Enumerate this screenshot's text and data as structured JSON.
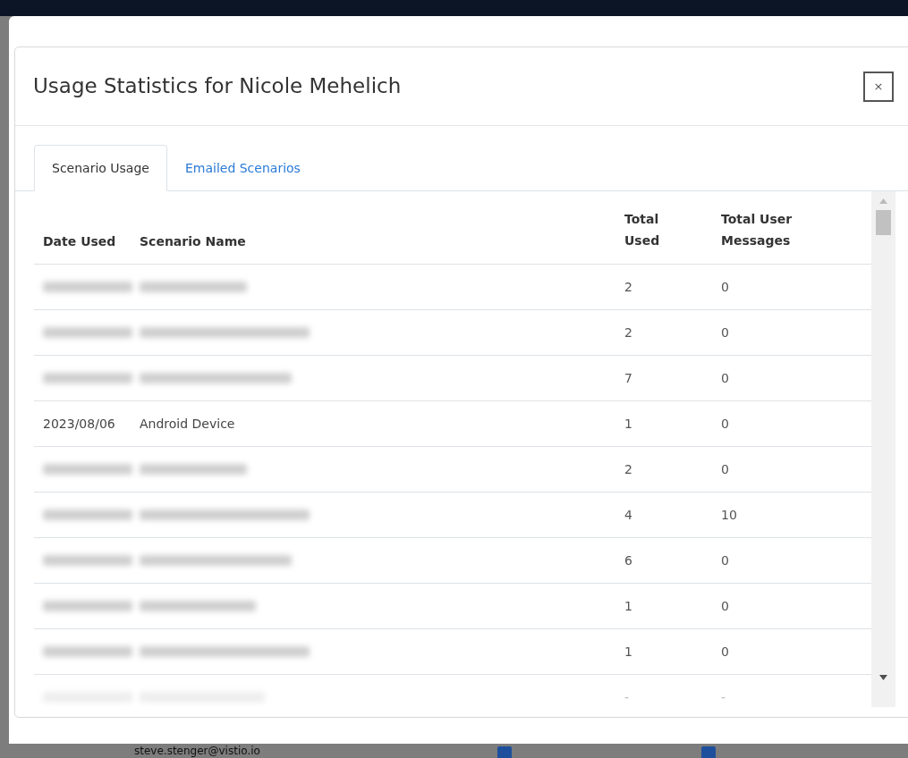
{
  "background": {
    "email": "steve.stenger@vistio.io",
    "checkboxes": [
      {
        "checked": true
      },
      {
        "checked": true
      }
    ]
  },
  "dialog": {
    "title": "Usage Statistics for Nicole Mehelich",
    "close": "×"
  },
  "tabs": [
    {
      "label": "Scenario Usage",
      "selected": true
    },
    {
      "label": "Emailed Scenarios",
      "selected": false
    }
  ],
  "table": {
    "columns": [
      "Date Used",
      "Scenario Name",
      [
        "Total",
        "Used"
      ],
      [
        "Total User",
        "Messages"
      ]
    ],
    "rows": [
      {
        "kind": "blurred",
        "total_used": "2",
        "total_user_messages": "0"
      },
      {
        "kind": "blurred",
        "total_used": "2",
        "total_user_messages": "0"
      },
      {
        "kind": "blurred",
        "total_used": "7",
        "total_user_messages": "0"
      },
      {
        "kind": "plain",
        "date_used": "2023/08/06",
        "scenario_name": "Android Device",
        "total_used": "1",
        "total_user_messages": "0"
      },
      {
        "kind": "blurred",
        "total_used": "2",
        "total_user_messages": "0"
      },
      {
        "kind": "blurred",
        "total_used": "4",
        "total_user_messages": "10"
      },
      {
        "kind": "blurred",
        "total_used": "6",
        "total_user_messages": "0"
      },
      {
        "kind": "blurred",
        "total_used": "1",
        "total_user_messages": "0"
      },
      {
        "kind": "blurred",
        "total_used": "1",
        "total_user_messages": "0"
      },
      {
        "kind": "blurred",
        "total_used": "-",
        "total_user_messages": "-"
      }
    ]
  }
}
